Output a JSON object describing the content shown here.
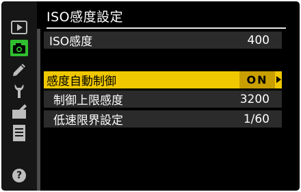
{
  "screen": {
    "title": "ISO感度設定"
  },
  "sidebar": {
    "items": [
      {
        "icon": "playback-icon"
      },
      {
        "icon": "camera-icon",
        "active": true
      },
      {
        "icon": "pencil-icon"
      },
      {
        "icon": "wrench-icon"
      },
      {
        "icon": "retouch-icon"
      },
      {
        "icon": "my-menu-icon"
      }
    ],
    "help": {
      "icon": "help-icon",
      "label": "?"
    }
  },
  "settings": {
    "iso": {
      "label": "ISO感度",
      "value": "400"
    },
    "auto_iso": {
      "label": "感度自動制御",
      "value": "ON",
      "selected": true
    },
    "max_sensitivity": {
      "label": "制御上限感度",
      "value": "3200"
    },
    "min_shutter": {
      "label": "低速限界設定",
      "value": "1/60"
    }
  },
  "colors": {
    "highlight": "#f0c800",
    "highlight_value": "#c99f00",
    "row_background": "#2b2b2b",
    "camera_tab_active": "#2fbf2f"
  }
}
